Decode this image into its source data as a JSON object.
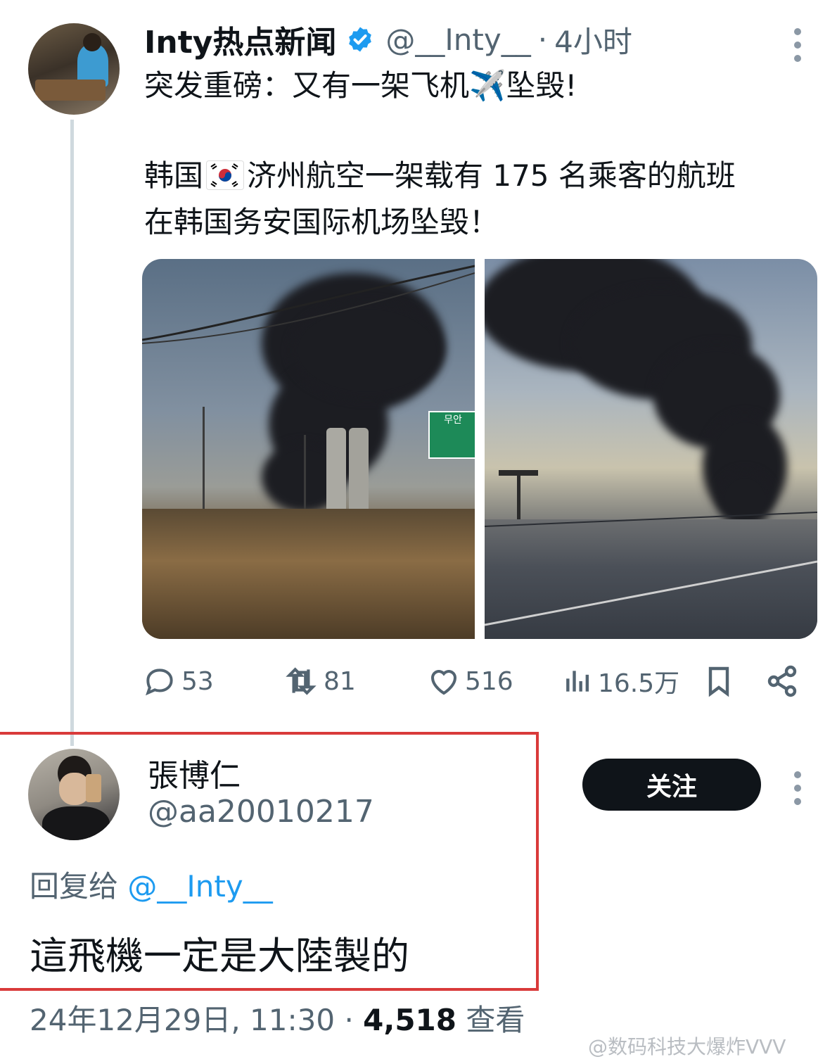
{
  "tweet": {
    "author_name": "Inty热点新闻",
    "handle": "@__Inty__",
    "separator": "·",
    "time": "4小时",
    "line1": "突发重磅：又有一架飞机",
    "plane_emoji": "✈️",
    "line1_end": "坠毁!",
    "line2_start": "韩国",
    "line2_end": "济州航空一架载有 175 名乘客的航班",
    "line3": "在韩国务安国际机场坠毁！",
    "sign_text": "무안",
    "metrics": {
      "replies": "53",
      "retweets": "81",
      "likes": "516",
      "views": "16.5万"
    }
  },
  "reply": {
    "name": "張博仁",
    "handle": "@aa20010217",
    "follow_label": "关注",
    "reply_to_prefix": "回复给",
    "reply_to_handle": "@__Inty__",
    "text": "這飛機一定是大陸製的",
    "date": "24年12月29日, 11:30",
    "separator": "·",
    "views_count": "4,518",
    "views_label": "查看"
  },
  "watermark": "@数码科技大爆炸VVV",
  "colors": {
    "verified": "#1d9bf0",
    "mention": "#1d9bf0",
    "highlight_border": "#d93a3a",
    "follow_button": "#0f1419"
  }
}
